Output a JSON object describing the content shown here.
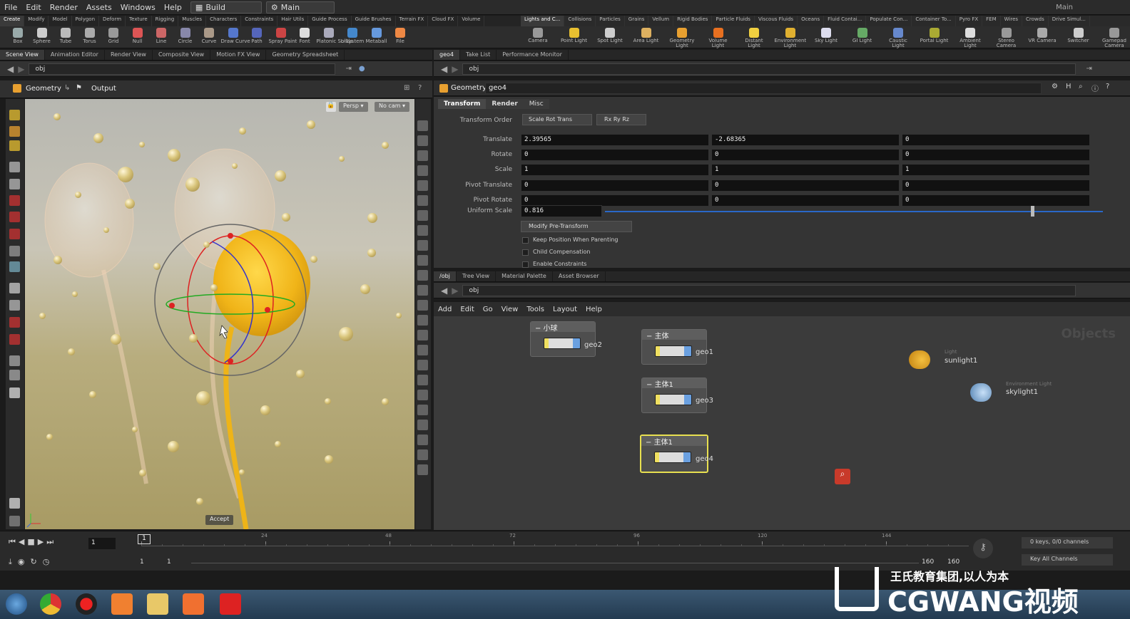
{
  "menu": {
    "items": [
      "File",
      "Edit",
      "Render",
      "Assets",
      "Windows",
      "Help"
    ],
    "desktop": "Build",
    "main": "Main",
    "right_label": "Main"
  },
  "shelf_tabs_left": [
    "Create",
    "Modify",
    "Model",
    "Polygon",
    "Deform",
    "Texture",
    "Rigging",
    "Muscles",
    "Characters",
    "Constraints",
    "Hair Utils",
    "Guide Process",
    "Guide Brushes",
    "Terrain FX",
    "Cloud FX",
    "Volume"
  ],
  "shelf_tabs_right": [
    "Lights and C...",
    "Collisions",
    "Particles",
    "Grains",
    "Vellum",
    "Rigid Bodies",
    "Particle Fluids",
    "Viscous Fluids",
    "Oceans",
    "Fluid Contai...",
    "Populate Con...",
    "Container To...",
    "Pyro FX",
    "FEM",
    "Wires",
    "Crowds",
    "Drive Simul..."
  ],
  "tools_left": [
    "Box",
    "Sphere",
    "Tube",
    "Torus",
    "Grid",
    "Null",
    "Line",
    "Circle",
    "Curve",
    "Draw Curve",
    "Path",
    "Spray Paint",
    "Font",
    "Platonic Solids",
    "L-System",
    "Metaball",
    "File"
  ],
  "tools_right": [
    "Camera",
    "Point Light",
    "Spot Light",
    "Area Light",
    "Geometry Light",
    "Volume Light",
    "Distant Light",
    "Environment Light",
    "Sky Light",
    "GI Light",
    "Caustic Light",
    "Portal Light",
    "Ambient Light",
    "Stereo Camera",
    "VR Camera",
    "Switcher",
    "Gamepad Camera"
  ],
  "left_tabs": [
    "Scene View",
    "Animation Editor",
    "Render View",
    "Composite View",
    "Motion FX View",
    "Geometry Spreadsheet"
  ],
  "right_tabs": [
    "geo4",
    "Take List",
    "Performance Monitor"
  ],
  "path": "obj",
  "viewport": {
    "geometry_label": "Geometry",
    "output_label": "Output",
    "persp": "Persp ▾",
    "cam": "No cam ▾",
    "accept": "Accept"
  },
  "params": {
    "type": "Geometry",
    "node": "geo4",
    "tabs": [
      "Transform",
      "Render",
      "Misc"
    ],
    "transform_order_label": "Transform Order",
    "transform_order": "Scale Rot Trans",
    "rot_order": "Rx Ry Rz",
    "rows": [
      {
        "label": "Translate",
        "v": [
          "2.39565",
          "-2.68365",
          "0"
        ]
      },
      {
        "label": "Rotate",
        "v": [
          "0",
          "0",
          "0"
        ]
      },
      {
        "label": "Scale",
        "v": [
          "1",
          "1",
          "1"
        ]
      },
      {
        "label": "Pivot Translate",
        "v": [
          "0",
          "0",
          "0"
        ]
      },
      {
        "label": "Pivot Rotate",
        "v": [
          "0",
          "0",
          "0"
        ]
      }
    ],
    "uniform_label": "Uniform Scale",
    "uniform": "0.816",
    "uniform_fraction": 0.86,
    "modify": "Modify Pre-Transform",
    "checks": [
      "Keep Position When Parenting",
      "Child Compensation",
      "Enable Constraints"
    ]
  },
  "net_tabs": [
    "/obj",
    "Tree View",
    "Material Palette",
    "Asset Browser"
  ],
  "net_menu": [
    "Add",
    "Edit",
    "Go",
    "View",
    "Tools",
    "Layout",
    "Help"
  ],
  "net_title": "Objects",
  "nodes": [
    {
      "head": "小球",
      "name": "geo2"
    },
    {
      "head": "主体",
      "name": "geo1"
    },
    {
      "head": "主体1",
      "name": "geo3"
    },
    {
      "head": "主体1",
      "name": "geo4"
    }
  ],
  "lights": [
    {
      "type": "Light",
      "name": "sunlight1"
    },
    {
      "type": "Environment Light",
      "name": "skylight1"
    }
  ],
  "timeline": {
    "frame": "1",
    "ticks": [
      "1",
      "24",
      "48",
      "72",
      "96",
      "120",
      "144"
    ],
    "start": "1",
    "start2": "1",
    "end": "160",
    "end2": "160",
    "keys": "0 keys, 0/0 channels",
    "key_all": "Key All Channels"
  },
  "watermark": {
    "line1": "王氏教育集团,以人为本",
    "line2": "CGWANG视频"
  },
  "taskbar_apps": [
    "start",
    "chrome",
    "recorder",
    "app",
    "explorer",
    "houdini",
    "youdao"
  ]
}
